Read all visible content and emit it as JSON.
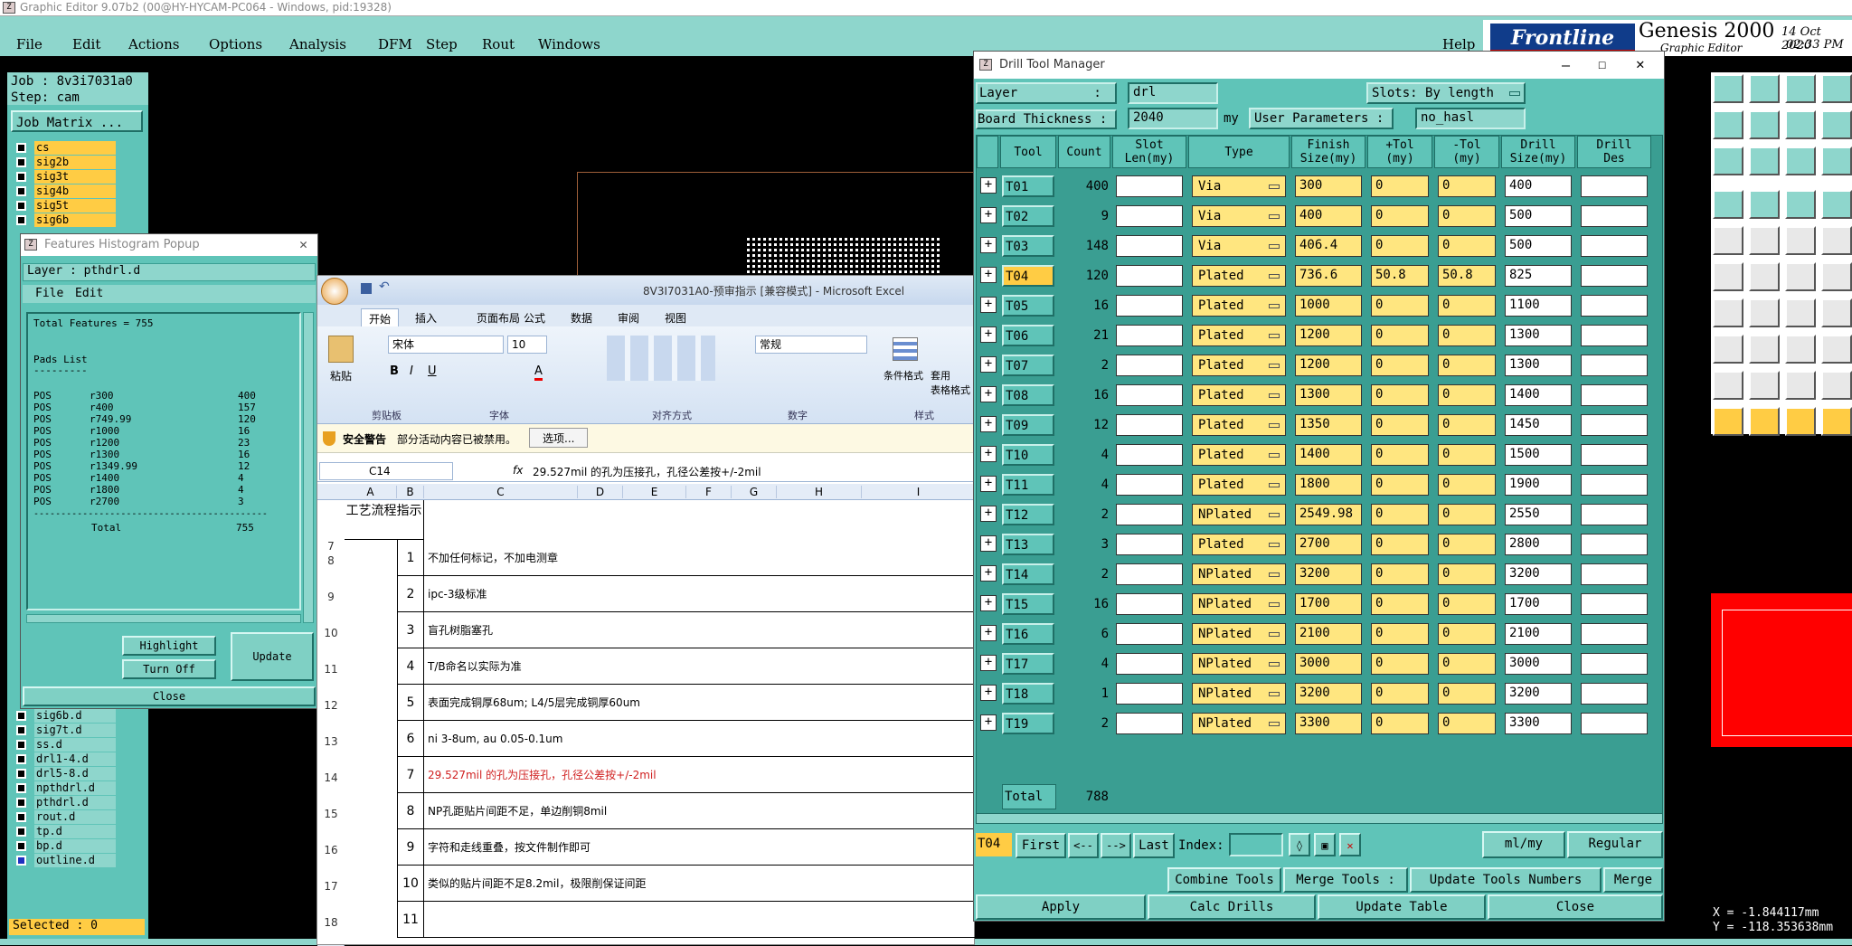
{
  "app": {
    "title": "Graphic Editor 9.07b2 (00@HY-HYCAM-PC064 - Windows, pid:19328)",
    "menu": [
      "File",
      "Edit",
      "Actions",
      "Options",
      "Analysis",
      "DFM",
      "Step",
      "Rout",
      "Windows"
    ],
    "help": "Help",
    "brand": "Frontline",
    "product": "Genesis 2000",
    "subtitle": "Graphic Editor",
    "date": "14 Oct 2020",
    "time": "02:33 PM"
  },
  "job": {
    "job": "Job : 8v3i7031a0",
    "step": "Step: cam",
    "matrix_btn": "Job Matrix ...",
    "selected": "Selected : 0",
    "layers_top": [
      "cs",
      "sig2b",
      "sig3t",
      "sig4b",
      "sig5t",
      "sig6b"
    ],
    "layers_bottom": [
      "sig6b.d",
      "sig7t.d",
      "ss.d",
      "drl1-4.d",
      "drl5-8.d",
      "npthdrl.d",
      "pthdrl.d",
      "rout.d",
      "tp.d",
      "bp.d",
      "outline.d"
    ]
  },
  "coords": {
    "x": "X = -1.844117mm",
    "y": "Y = -118.353638mm"
  },
  "histogram": {
    "title": "Features Histogram Popup",
    "layer": "Layer : pthdrl.d",
    "menu": [
      "File",
      "Edit"
    ],
    "total": "Total Features = 755",
    "pads_header": "Pads List",
    "separator": "---------",
    "rows": [
      [
        "POS",
        "r300",
        "400"
      ],
      [
        "POS",
        "r400",
        "157"
      ],
      [
        "POS",
        "r749.99",
        "120"
      ],
      [
        "POS",
        "r1000",
        "16"
      ],
      [
        "POS",
        "r1200",
        "23"
      ],
      [
        "POS",
        "r1300",
        "16"
      ],
      [
        "POS",
        "r1349.99",
        "12"
      ],
      [
        "POS",
        "r1400",
        "4"
      ],
      [
        "POS",
        "r1800",
        "4"
      ],
      [
        "POS",
        "r2700",
        "3"
      ]
    ],
    "line": "-------------------------------------------",
    "total_label": "Total",
    "total_value": "755",
    "highlight": "Highlight",
    "turn_off": "Turn Off",
    "update": "Update",
    "close": "Close"
  },
  "excel": {
    "title": "8V3I7031A0-预审指示 [兼容模式] - Microsoft Excel",
    "tabs": [
      "开始",
      "插入",
      "页面布局",
      "公式",
      "数据",
      "审阅",
      "视图"
    ],
    "font": "宋体",
    "size": "10",
    "number_format": "常规",
    "groups": [
      "剪贴板",
      "字体",
      "对齐方式",
      "数字",
      "样式"
    ],
    "paste": "粘贴",
    "cond_format": "条件格式",
    "table_format": "套用\n表格格式",
    "security_title": "安全警告",
    "security_msg": "部分活动内容已被禁用。",
    "options_btn": "选项...",
    "cell_ref": "C14",
    "formula": "29.527mil 的孔为压接孔，孔径公差按+/-2mil",
    "columns": [
      "A",
      "B",
      "C",
      "D",
      "E",
      "F",
      "G",
      "H",
      "I"
    ],
    "header_cell": "工艺流程指示",
    "rows": [
      {
        "r": "7",
        "n": "",
        "t": ""
      },
      {
        "r": "8",
        "n": "1",
        "t": "不加任何标记，不加电测章"
      },
      {
        "r": "9",
        "n": "2",
        "t": "ipc-3级标准"
      },
      {
        "r": "10",
        "n": "3",
        "t": "盲孔树脂塞孔"
      },
      {
        "r": "11",
        "n": "4",
        "t": "T/B命名以实际为准"
      },
      {
        "r": "12",
        "n": "5",
        "t": "表面完成铜厚68um; L4/5层完成铜厚60um"
      },
      {
        "r": "13",
        "n": "6",
        "t": "ni 3-8um, au 0.05-0.1um"
      },
      {
        "r": "14",
        "n": "7",
        "t": "29.527mil 的孔为压接孔，孔径公差按+/-2mil"
      },
      {
        "r": "15",
        "n": "8",
        "t": "NP孔距贴片间距不足，单边削铜8mil"
      },
      {
        "r": "16",
        "n": "9",
        "t": "字符和走线重叠，按文件制作即可"
      },
      {
        "r": "17",
        "n": "10",
        "t": "类似的贴片间距不足8.2mil，极限削保证间距"
      },
      {
        "r": "18",
        "n": "11",
        "t": ""
      }
    ]
  },
  "dtm": {
    "title": "Drill Tool Manager",
    "layer_label": "Layer          :",
    "layer": "drl",
    "slots_label": "Slots:",
    "slots": "By length",
    "thickness_label": "Board Thickness :",
    "thickness": "2040",
    "unit": "my",
    "user_params_label": "User Parameters :",
    "user_params": "no_hasl",
    "headers": [
      "Tool",
      "Count",
      "Slot\nLen(my)",
      "Type",
      "Finish\nSize(my)",
      "+Tol\n(my)",
      "-Tol\n(my)",
      "Drill\nSize(my)",
      "Drill\nDes"
    ],
    "tools": [
      [
        "T01",
        "400",
        "Via",
        "300",
        "0",
        "0",
        "400"
      ],
      [
        "T02",
        "9",
        "Via",
        "400",
        "0",
        "0",
        "500"
      ],
      [
        "T03",
        "148",
        "Via",
        "406.4",
        "0",
        "0",
        "500"
      ],
      [
        "T04",
        "120",
        "Plated",
        "736.6",
        "50.8",
        "50.8",
        "825"
      ],
      [
        "T05",
        "16",
        "Plated",
        "1000",
        "0",
        "0",
        "1100"
      ],
      [
        "T06",
        "21",
        "Plated",
        "1200",
        "0",
        "0",
        "1300"
      ],
      [
        "T07",
        "2",
        "Plated",
        "1200",
        "0",
        "0",
        "1300"
      ],
      [
        "T08",
        "16",
        "Plated",
        "1300",
        "0",
        "0",
        "1400"
      ],
      [
        "T09",
        "12",
        "Plated",
        "1350",
        "0",
        "0",
        "1450"
      ],
      [
        "T10",
        "4",
        "Plated",
        "1400",
        "0",
        "0",
        "1500"
      ],
      [
        "T11",
        "4",
        "Plated",
        "1800",
        "0",
        "0",
        "1900"
      ],
      [
        "T12",
        "2",
        "NPlated",
        "2549.98",
        "0",
        "0",
        "2550"
      ],
      [
        "T13",
        "3",
        "Plated",
        "2700",
        "0",
        "0",
        "2800"
      ],
      [
        "T14",
        "2",
        "NPlated",
        "3200",
        "0",
        "0",
        "3200"
      ],
      [
        "T15",
        "16",
        "NPlated",
        "1700",
        "0",
        "0",
        "1700"
      ],
      [
        "T16",
        "6",
        "NPlated",
        "2100",
        "0",
        "0",
        "2100"
      ],
      [
        "T17",
        "4",
        "NPlated",
        "3000",
        "0",
        "0",
        "3000"
      ],
      [
        "T18",
        "1",
        "NPlated",
        "3200",
        "0",
        "0",
        "3200"
      ],
      [
        "T19",
        "2",
        "NPlated",
        "3300",
        "0",
        "0",
        "3300"
      ]
    ],
    "total_label": "Total",
    "total": "788",
    "current_tool": "T04",
    "first": "First",
    "prev": "<--",
    "next": "-->",
    "last": "Last",
    "index_label": "Index:",
    "units": "ml/my",
    "mode": "Regular",
    "combine": "Combine Tools",
    "merge_tools": "Merge Tools :",
    "update_numbers": "Update Tools Numbers",
    "merge": "Merge",
    "apply": "Apply",
    "calc": "Calc Drills",
    "update_table": "Update Table",
    "close": "Close"
  }
}
